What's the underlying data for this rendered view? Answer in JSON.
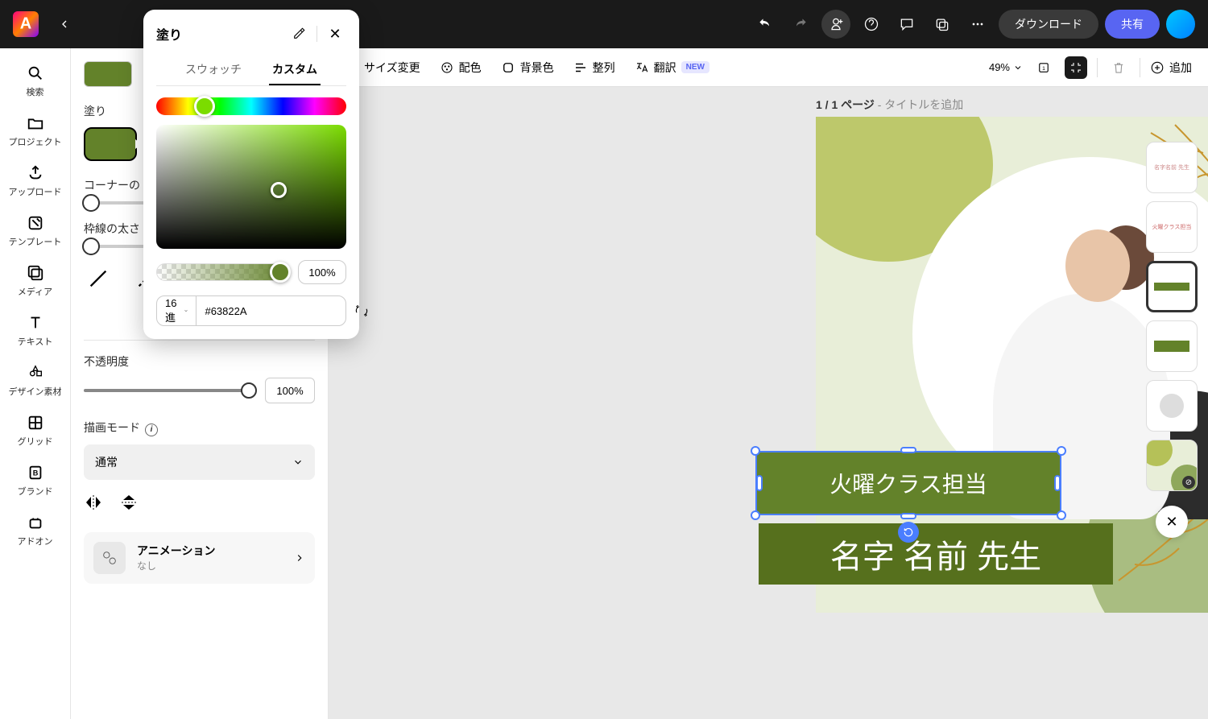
{
  "topbar": {
    "download": "ダウンロード",
    "share": "共有"
  },
  "rail": {
    "search": "検索",
    "project": "プロジェクト",
    "upload": "アップロード",
    "template": "テンプレート",
    "media": "メディア",
    "text": "テキスト",
    "elements": "デザイン素材",
    "grid": "グリッド",
    "brand": "ブランド",
    "addon": "アドオン"
  },
  "props": {
    "fill": "塗り",
    "corner": "コーナーの",
    "stroke": "枠線の太さ",
    "opacity": "不透明度",
    "opacity_val": "100%",
    "blend": "描画モード",
    "blend_val": "通常",
    "animation": "アニメーション",
    "animation_sub": "なし"
  },
  "popup": {
    "title": "塗り",
    "tab_swatch": "スウォッチ",
    "tab_custom": "カスタム",
    "alpha_val": "100%",
    "hex_mode": "16 進",
    "hex_val": "#63822A"
  },
  "toolbar2": {
    "resize": "サイズ変更",
    "colorize": "配色",
    "bgcolor": "背景色",
    "align": "整列",
    "translate": "翻訳",
    "new_badge": "NEW",
    "zoom": "49%",
    "add": "追加"
  },
  "page": {
    "label": "1 / 1 ページ",
    "title_hint": "- タイトルを追加"
  },
  "canvas": {
    "label1": "火曜クラス担当",
    "label2": "名字 名前 先生"
  },
  "colors": {
    "accent": "#63822A",
    "accent_dark": "#56701d",
    "primary": "#5865f2"
  }
}
